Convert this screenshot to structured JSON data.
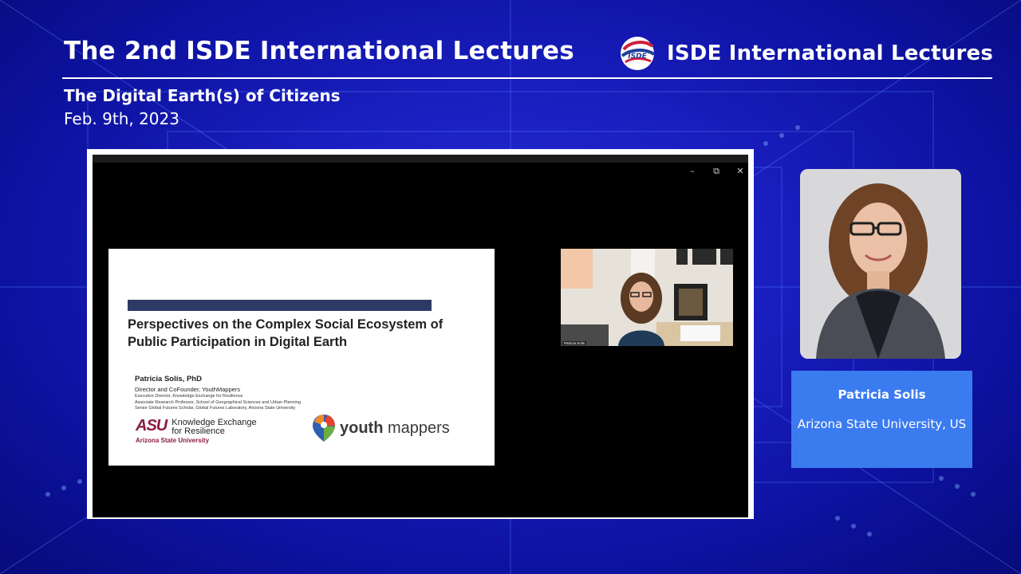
{
  "header": {
    "title": "The 2nd ISDE International Lectures",
    "brand_logo_text": "ISDE",
    "brand_text": "ISDE International Lectures",
    "subtitle": "The Digital Earth(s) of Citizens",
    "date": "Feb. 9th, 2023"
  },
  "video": {
    "controls": {
      "minimize": "–",
      "restore": "⧉",
      "close": "✕"
    },
    "slide": {
      "title": "Perspectives on the Complex Social Ecosystem of Public Participation in Digital Earth",
      "author": "Patricia Solís, PhD",
      "role_main": "Director and CoFounder, YouthMappers",
      "roles": [
        "Executive Director, Knowledge Exchange for Resilience",
        "Associate Research Professor, School of Geographical Sciences and Urban Planning",
        "Senior Global Futures Scholar, Global Futures Laboratory, Arizona State University"
      ],
      "asu_mark": "ASU",
      "asu_ker_line1": "Knowledge Exchange",
      "asu_ker_line2": "for Resilience",
      "asu_name": "Arizona State University",
      "ym_text_bold": "youth",
      "ym_text_regular": " mappers"
    },
    "webcam": {
      "name_label": "Patricia Solis"
    }
  },
  "speaker": {
    "name": "Patricia Solis",
    "affiliation": "Arizona State University, US"
  },
  "colors": {
    "background": "#1a1fc0",
    "name_card": "#3b7bf0",
    "slide_bar": "#2e3a66",
    "asu_maroon": "#8c1d40"
  }
}
